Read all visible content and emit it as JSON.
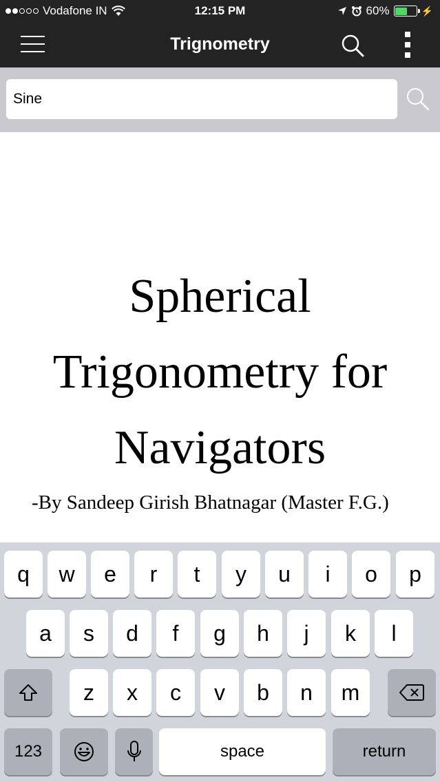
{
  "status_bar": {
    "carrier": "Vodafone IN",
    "time": "12:15 PM",
    "battery_percent": "60%",
    "battery_level": 0.6,
    "signal_bars_filled": 2,
    "signal_bars_total": 5
  },
  "nav": {
    "title": "Trignometry"
  },
  "search": {
    "value": "Sine"
  },
  "document": {
    "title_lines": [
      "Spherical",
      "Trigonometry for",
      "Navigators"
    ],
    "byline": "-By Sandeep Girish Bhatnagar (Master F.G.)"
  },
  "keyboard": {
    "row1": [
      "q",
      "w",
      "e",
      "r",
      "t",
      "y",
      "u",
      "i",
      "o",
      "p"
    ],
    "row2": [
      "a",
      "s",
      "d",
      "f",
      "g",
      "h",
      "j",
      "k",
      "l"
    ],
    "row3": [
      "z",
      "x",
      "c",
      "v",
      "b",
      "n",
      "m"
    ],
    "numbers_label": "123",
    "space_label": "space",
    "return_label": "return"
  },
  "colors": {
    "nav_background": "#232323",
    "search_strip": "#c9c9ce",
    "keyboard_background": "#d1d4da",
    "battery_green": "#4cd964",
    "caret_blue": "#1a73e8"
  },
  "icons": {
    "menu": "hamburger-icon",
    "search": "search-icon",
    "more": "more-vertical-icon",
    "shift": "shift-icon",
    "delete": "backspace-icon",
    "emoji": "emoji-icon",
    "mic": "microphone-icon"
  }
}
